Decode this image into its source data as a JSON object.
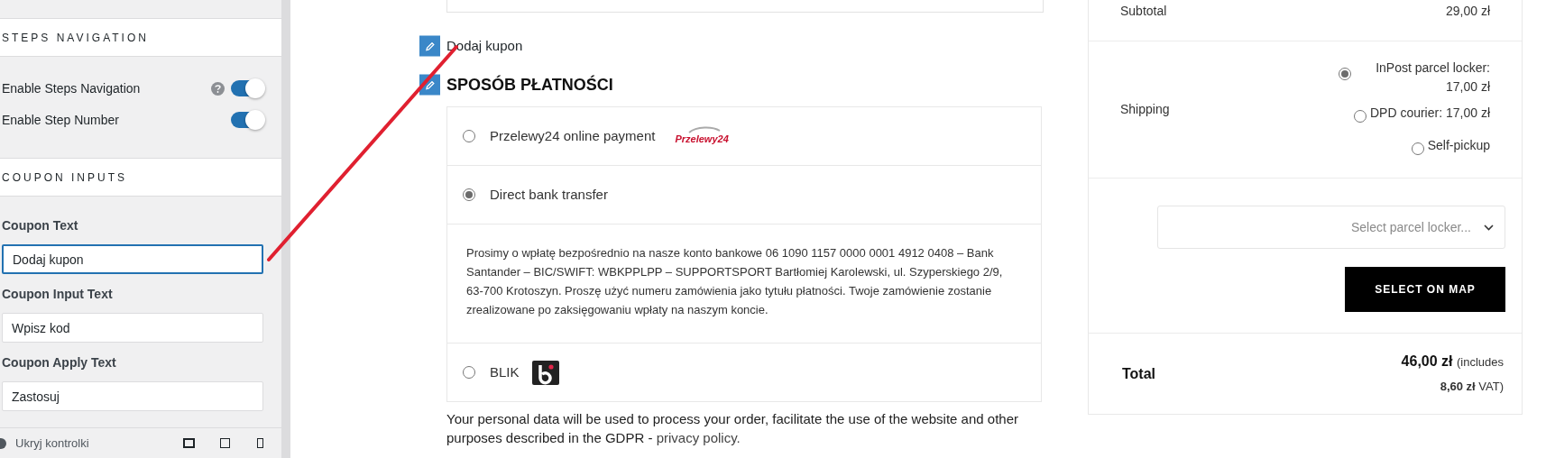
{
  "sidebar": {
    "sections": [
      {
        "title": "STEPS NAVIGATION",
        "rows": [
          {
            "kind": "toggle",
            "label": "Enable Steps Navigation",
            "help": true,
            "on": true
          },
          {
            "kind": "toggle",
            "label": "Enable Step Number",
            "help": false,
            "on": true
          }
        ]
      },
      {
        "title": "COUPON INPUTS",
        "rows": [
          {
            "kind": "text_field",
            "label": "Coupon Text",
            "value": "Dodaj kupon",
            "focused": true
          },
          {
            "kind": "text_field",
            "label": "Coupon Input Text",
            "value": "Wpisz kod",
            "focused": false
          },
          {
            "kind": "text_field",
            "label": "Coupon Apply Text",
            "value": "Zastosuj",
            "focused": false
          }
        ]
      }
    ],
    "footer": {
      "label": "Ukryj kontrolki"
    }
  },
  "checkout": {
    "coupon_link": "Dodaj kupon",
    "payment_heading": "SPOSÓB PŁATNOŚCI",
    "payment_methods": [
      {
        "label": "Przelewy24 online payment",
        "selected": false,
        "kind": "przelewy24",
        "logo_text": "Przelewy24"
      },
      {
        "label": "Direct bank transfer",
        "selected": true,
        "kind": "plain",
        "description": "Prosimy o wpłatę bezpośrednio na nasze konto bankowe 06 1090 1157 0000 0001 4912 0408 – Bank Santander – BIC/SWIFT: WBKPPLPP – SUPPORTSPORT Bartłomiej Karolewski, ul. Szyperskiego 2/9, 63-700 Krotoszyn. Proszę użyć numeru zamówienia jako tytułu płatności. Twoje zamówienie zostanie zrealizowane po zaksięgowaniu wpłaty na naszym koncie."
      },
      {
        "label": "BLIK",
        "selected": false,
        "kind": "blik"
      }
    ],
    "privacy_note": "Your personal data will be used to process your order, facilitate the use of the website and other purposes described in the GDPR -",
    "privacy_link": "privacy policy."
  },
  "summary": {
    "subtotal_label": "Subtotal",
    "subtotal_value": "29,00 zł",
    "shipping_label": "Shipping",
    "shipping_options": [
      {
        "label": "InPost parcel locker: 17,00 zł",
        "selected": true
      },
      {
        "label": "DPD courier: 17,00 zł",
        "selected": false
      },
      {
        "label": "Self-pickup",
        "selected": false
      }
    ],
    "locker_select": {
      "placeholder": "Select parcel locker..."
    },
    "map_button": "SELECT ON MAP",
    "total_label": "Total",
    "total_amount": "46,00 zł",
    "total_note": "(includes **8,60 zł** VAT)"
  }
}
